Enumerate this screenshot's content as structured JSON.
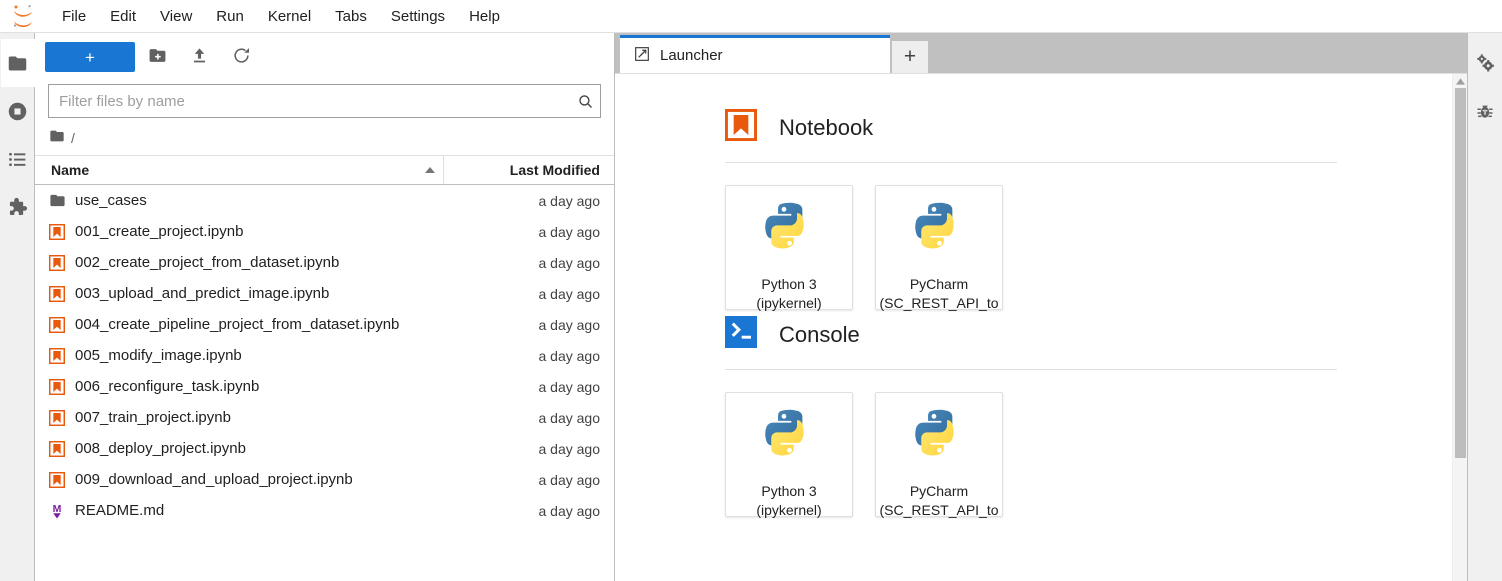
{
  "app": {
    "title": "JupyterLab",
    "logo_icon": "jupyter-logo-icon",
    "accent_color": "#1976d2",
    "notebook_color": "#e8590c",
    "markdown_color": "#7b1fa2"
  },
  "menubar": {
    "items": [
      {
        "label": "File",
        "name": "menu-file"
      },
      {
        "label": "Edit",
        "name": "menu-edit"
      },
      {
        "label": "View",
        "name": "menu-view"
      },
      {
        "label": "Run",
        "name": "menu-run"
      },
      {
        "label": "Kernel",
        "name": "menu-kernel"
      },
      {
        "label": "Tabs",
        "name": "menu-tabs"
      },
      {
        "label": "Settings",
        "name": "menu-settings"
      },
      {
        "label": "Help",
        "name": "menu-help"
      }
    ]
  },
  "left_sidebar": {
    "items": [
      {
        "icon": "folder-icon",
        "name": "sidebar-item-file-browser",
        "active": true
      },
      {
        "icon": "running-terminals-icon",
        "name": "sidebar-item-running",
        "active": false
      },
      {
        "icon": "command-palette-icon",
        "name": "sidebar-item-commands",
        "active": false
      },
      {
        "icon": "extension-puzzle-icon",
        "name": "sidebar-item-extensions",
        "active": false
      }
    ]
  },
  "right_sidebar": {
    "items": [
      {
        "icon": "property-inspector-gears-icon",
        "name": "sidebar-item-property-inspector"
      },
      {
        "icon": "debugger-bug-icon",
        "name": "sidebar-item-debugger"
      }
    ]
  },
  "file_browser": {
    "toolbar": {
      "new_launcher_label": "+",
      "new_folder_icon": "new-folder-icon",
      "upload_icon": "upload-icon",
      "refresh_icon": "refresh-icon"
    },
    "filter": {
      "placeholder": "Filter files by name",
      "value": "",
      "search_icon": "search-icon"
    },
    "breadcrumb": {
      "root_icon": "folder-icon",
      "path": "/"
    },
    "columns": {
      "name": "Name",
      "last_modified": "Last Modified",
      "sort_direction": "ascending"
    },
    "files": [
      {
        "name": "use_cases",
        "modified": "a day ago",
        "icon": "folder-icon",
        "type": "directory"
      },
      {
        "name": "001_create_project.ipynb",
        "modified": "a day ago",
        "icon": "notebook-icon",
        "type": "notebook"
      },
      {
        "name": "002_create_project_from_dataset.ipynb",
        "modified": "a day ago",
        "icon": "notebook-icon",
        "type": "notebook"
      },
      {
        "name": "003_upload_and_predict_image.ipynb",
        "modified": "a day ago",
        "icon": "notebook-icon",
        "type": "notebook"
      },
      {
        "name": "004_create_pipeline_project_from_dataset.ipynb",
        "modified": "a day ago",
        "icon": "notebook-icon",
        "type": "notebook"
      },
      {
        "name": "005_modify_image.ipynb",
        "modified": "a day ago",
        "icon": "notebook-icon",
        "type": "notebook"
      },
      {
        "name": "006_reconfigure_task.ipynb",
        "modified": "a day ago",
        "icon": "notebook-icon",
        "type": "notebook"
      },
      {
        "name": "007_train_project.ipynb",
        "modified": "a day ago",
        "icon": "notebook-icon",
        "type": "notebook"
      },
      {
        "name": "008_deploy_project.ipynb",
        "modified": "a day ago",
        "icon": "notebook-icon",
        "type": "notebook"
      },
      {
        "name": "009_download_and_upload_project.ipynb",
        "modified": "a day ago",
        "icon": "notebook-icon",
        "type": "notebook"
      },
      {
        "name": "README.md",
        "modified": "a day ago",
        "icon": "markdown-icon",
        "type": "markdown"
      }
    ]
  },
  "main": {
    "tabs": [
      {
        "label": "Launcher",
        "icon": "launcher-icon",
        "active": true
      }
    ],
    "new_tab_label": "+",
    "launcher": {
      "sections": [
        {
          "title": "Notebook",
          "icon": "notebook-icon",
          "cards": [
            {
              "line1": "Python 3",
              "line2": "(ipykernel)",
              "icon": "python-logo-icon"
            },
            {
              "line1": "PyCharm",
              "line2": "(SC_REST_API_to",
              "icon": "python-logo-icon"
            }
          ]
        },
        {
          "title": "Console",
          "icon": "terminal-icon",
          "cards": [
            {
              "line1": "Python 3",
              "line2": "(ipykernel)",
              "icon": "python-logo-icon"
            },
            {
              "line1": "PyCharm",
              "line2": "(SC_REST_API_to",
              "icon": "python-logo-icon"
            }
          ]
        }
      ]
    }
  }
}
